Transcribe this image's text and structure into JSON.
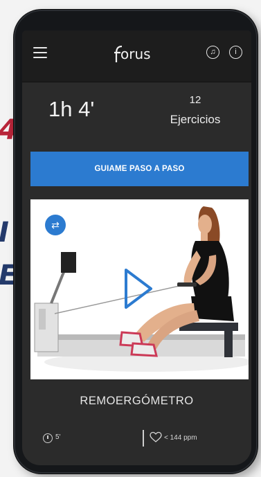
{
  "background": {
    "fragment_red": "4",
    "fragment_navy_1": "I",
    "fragment_navy_2": "E"
  },
  "header": {
    "logo_text": "orus",
    "menu_icon": "hamburger-icon",
    "music_icon": "music-icon",
    "info_icon": "info-icon"
  },
  "stats": {
    "duration": "1h 4'",
    "exercise_count": "12",
    "exercise_label": "Ejercicios"
  },
  "guide_button": {
    "label": "GUIAME PASO A PASO"
  },
  "video": {
    "shuffle_icon": "shuffle-icon",
    "play_icon": "play-icon"
  },
  "exercise": {
    "name": "REMOERGÓMETRO",
    "rest_time": "5'",
    "heart_rate": "< 144 ppm"
  },
  "colors": {
    "accent": "#2c7bd0",
    "screen_bg": "#2b2b2b",
    "topbar_bg": "#1d1d1d"
  }
}
